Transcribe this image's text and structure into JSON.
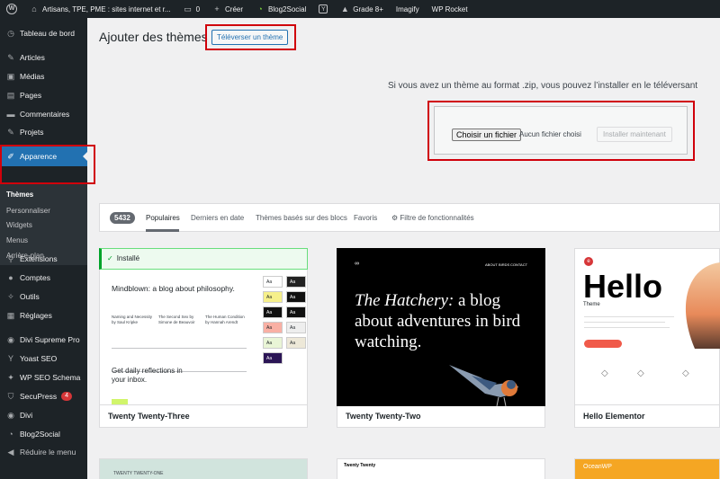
{
  "adminbar": {
    "site_name": "Artisans, TPE, PME : sites internet et r...",
    "comments": "0",
    "create": "Créer",
    "blog2social": "Blog2Social",
    "grade": "Grade 8+",
    "imagify": "Imagify",
    "wprocket": "WP Rocket"
  },
  "sidebar": {
    "items": [
      {
        "label": "Tableau de bord",
        "icon": "dashboard-icon"
      },
      {
        "label": "Articles",
        "icon": "pin-icon"
      },
      {
        "label": "Médias",
        "icon": "media-icon"
      },
      {
        "label": "Pages",
        "icon": "page-icon"
      },
      {
        "label": "Commentaires",
        "icon": "comment-icon"
      },
      {
        "label": "Projets",
        "icon": "pin-icon"
      },
      {
        "label": "Apparence",
        "icon": "brush-icon"
      },
      {
        "label": "Extensions",
        "icon": "plugin-icon"
      },
      {
        "label": "Comptes",
        "icon": "user-icon"
      },
      {
        "label": "Outils",
        "icon": "wrench-icon"
      },
      {
        "label": "Réglages",
        "icon": "settings-icon"
      },
      {
        "label": "Divi Supreme Pro",
        "icon": "divi-icon"
      },
      {
        "label": "Yoast SEO",
        "icon": "yoast-icon"
      },
      {
        "label": "WP SEO Schema",
        "icon": "schema-icon"
      },
      {
        "label": "SecuPress",
        "icon": "shield-icon",
        "badge": "4"
      },
      {
        "label": "Divi",
        "icon": "divi-icon"
      },
      {
        "label": "Blog2Social",
        "icon": "b2s-icon"
      },
      {
        "label": "Réduire le menu",
        "icon": "collapse-icon"
      }
    ],
    "submenu": [
      "Thèmes",
      "Personnaliser",
      "Widgets",
      "Menus",
      "Arrière-plan"
    ]
  },
  "main": {
    "title": "Ajouter des thèmes",
    "upload_button": "Téléverser un thème",
    "upload_description": "Si vous avez un thème au format .zip, vous pouvez l’installer en le téléversant",
    "choose_file": "Choisir un fichier",
    "no_file": "Aucun fichier choisi",
    "install_now": "Installer maintenant"
  },
  "filter": {
    "count": "5432",
    "tabs": [
      "Populaires",
      "Derniers en date",
      "Thèmes basés sur des blocs",
      "Favoris"
    ],
    "feature_filter": "Filtre de fonctionnalités"
  },
  "themes": [
    {
      "name": "Twenty Twenty-Three",
      "installed_label": "Installé",
      "preview": {
        "headline": "Mindblown: a blog about philosophy.",
        "posts": [
          "Naming and Necessity by Saul Kripke",
          "The Second Sex by Simone de Beauvoir",
          "The Human Condition by Hannah Arendt"
        ],
        "footer": "Get daily reflections in your inbox."
      }
    },
    {
      "name": "Twenty Twenty-Two",
      "preview": {
        "headline": "The Hatchery: a blog about adventures in bird watching.",
        "headline_em": "The Hatchery:",
        "headline_rest": " a blog about adventures in bird watching.",
        "nav": [
          "ABOUT",
          "BIRDS",
          "CONTACT"
        ]
      }
    },
    {
      "name": "Hello Elementor",
      "preview": {
        "headline": "Hello",
        "subtitle": "Theme"
      }
    }
  ],
  "bottom_cards": [
    {
      "label": "TWENTY TWENTY-ONE"
    },
    {
      "label": "Twenty Twenty"
    },
    {
      "label": "OceanWP"
    }
  ],
  "colors": {
    "accent": "#2271b1",
    "sidebar": "#1d2327",
    "highlight_box": "#d0000b",
    "installed_green": "#00a32a"
  }
}
